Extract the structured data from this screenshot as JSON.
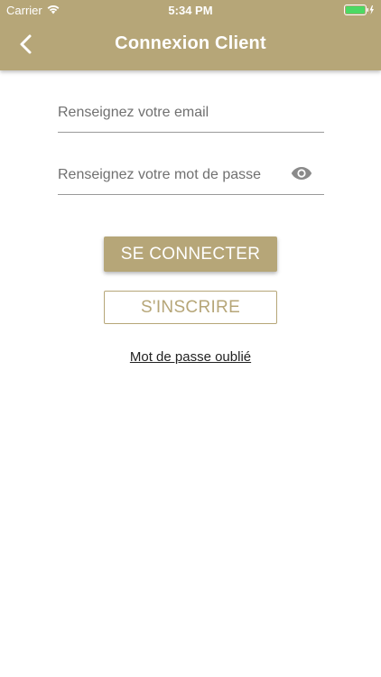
{
  "status_bar": {
    "carrier": "Carrier",
    "time": "5:34 PM",
    "battery_color": "#4cd964"
  },
  "nav": {
    "title": "Connexion Client",
    "back_icon": "chevron-left-icon"
  },
  "form": {
    "email_placeholder": "Renseignez votre email",
    "email_value": "",
    "password_placeholder": "Renseignez votre mot de passe",
    "password_value": "",
    "password_toggle_icon": "eye-icon"
  },
  "actions": {
    "connect_label": "SE CONNECTER",
    "register_label": "S'INSCRIRE",
    "forgot_label": "Mot de passe oublié"
  },
  "colors": {
    "accent": "#b6a678",
    "background": "#ffffff"
  }
}
